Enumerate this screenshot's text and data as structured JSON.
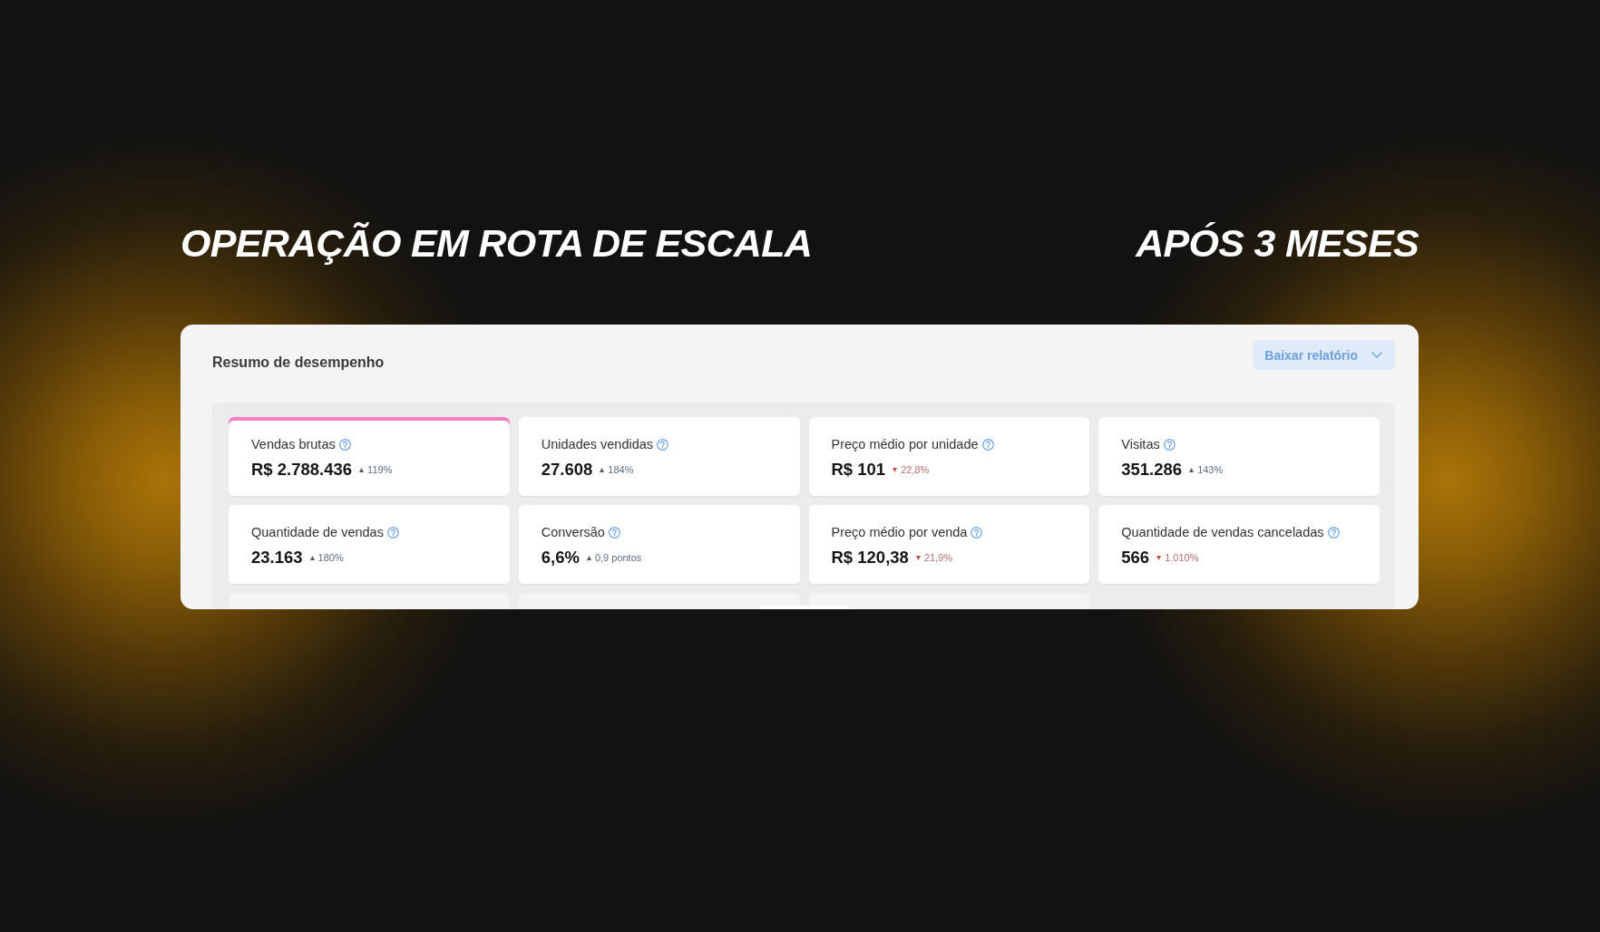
{
  "headline": {
    "left": "OPERAÇÃO EM ROTA DE ESCALA",
    "right": "APÓS 3 MESES"
  },
  "panel": {
    "title": "Resumo de desempenho",
    "download_button": {
      "label": "Baixar relatório"
    },
    "metrics": [
      {
        "kind": "metric",
        "label": "Vendas brutas",
        "value": "R$ 2.788.436",
        "change": "119%",
        "rising": true,
        "selected": true
      },
      {
        "kind": "metric",
        "label": "Unidades vendidas",
        "value": "27.608",
        "change": "184%",
        "rising": true,
        "selected": false
      },
      {
        "kind": "metric",
        "label": "Preço médio por unidade",
        "value": "R$ 101",
        "change": "22,8%",
        "rising": false,
        "selected": false
      },
      {
        "kind": "metric",
        "label": "Visitas",
        "value": "351.286",
        "change": "143%",
        "rising": true,
        "selected": false
      },
      {
        "kind": "metric",
        "label": "Quantidade de vendas",
        "value": "23.163",
        "change": "180%",
        "rising": true,
        "selected": false
      },
      {
        "kind": "metric",
        "label": "Conversão",
        "value": "6,6%",
        "change": "0,9 pontos",
        "rising": true,
        "selected": false
      },
      {
        "kind": "metric",
        "label": "Preço médio por venda",
        "value": "R$ 120,38",
        "change": "21,9%",
        "rising": false,
        "selected": false
      },
      {
        "kind": "metric",
        "label": "Quantidade de vendas canceladas",
        "value": "566",
        "change": "1.010%",
        "rising": false,
        "selected": false
      },
      {
        "kind": "clipped",
        "selected": false
      },
      {
        "kind": "clipped",
        "selected": false
      },
      {
        "kind": "clipped",
        "selected": false
      }
    ]
  }
}
